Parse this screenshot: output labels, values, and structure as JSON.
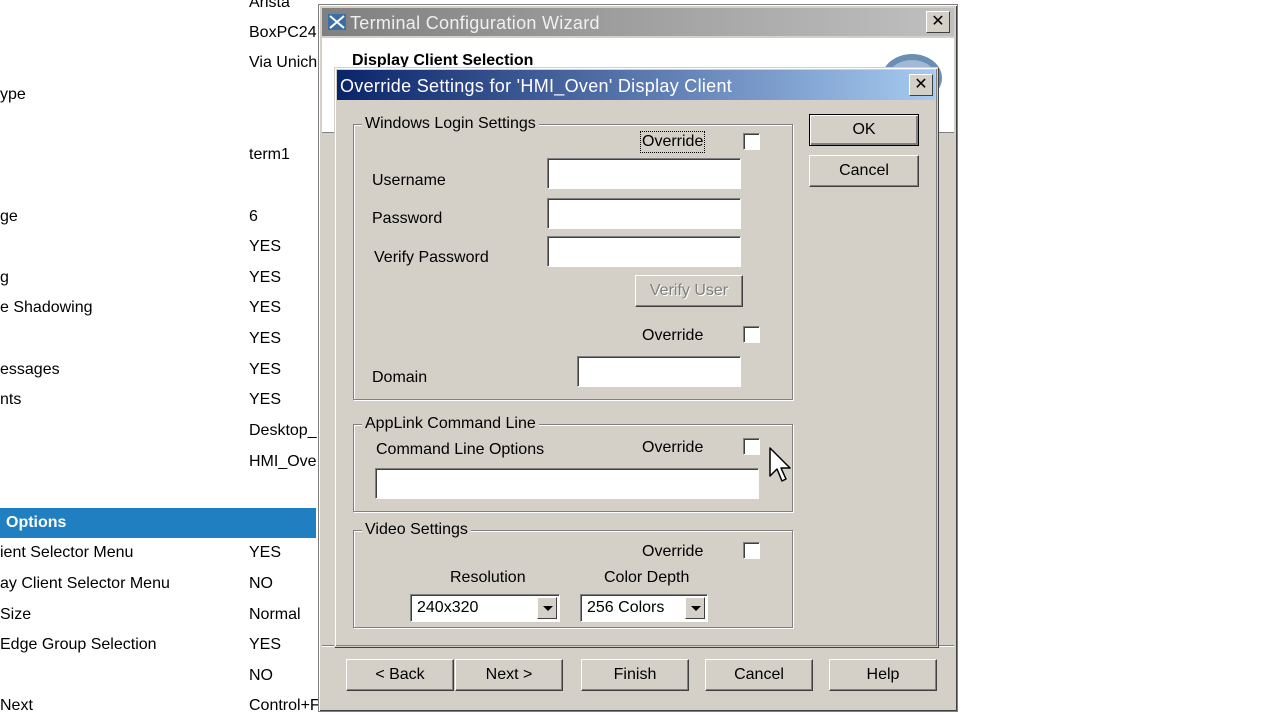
{
  "background_list": {
    "rows": [
      {
        "key": "",
        "value": "Arista"
      },
      {
        "key": "",
        "value": "BoxPC24"
      },
      {
        "key": "",
        "value": "Via Unich"
      },
      {
        "key": "ype",
        "value": ""
      },
      {
        "key": "",
        "value": "term1"
      },
      {
        "key": "ge",
        "value": "6"
      },
      {
        "key": "",
        "value": "YES"
      },
      {
        "key": "g",
        "value": "YES"
      },
      {
        "key": "e Shadowing",
        "value": "YES"
      },
      {
        "key": "",
        "value": "YES"
      },
      {
        "key": "essages",
        "value": "YES"
      },
      {
        "key": "nts",
        "value": "YES"
      },
      {
        "key": "",
        "value": "Desktop_"
      },
      {
        "key": "",
        "value": "HMI_Ove"
      },
      {
        "key": "ient Selector Menu",
        "value": "YES"
      },
      {
        "key": "ay Client Selector Menu",
        "value": "NO"
      },
      {
        "key": "Size",
        "value": "Normal"
      },
      {
        "key": "Edge Group Selection",
        "value": "YES"
      },
      {
        "key": "",
        "value": "NO"
      },
      {
        "key": "Next",
        "value": "Control+F"
      }
    ],
    "section_header": "Options"
  },
  "wizard": {
    "title": "Terminal Configuration Wizard",
    "close_label": "✕",
    "header_title": "Display Client Selection",
    "buttons": {
      "back": "< Back",
      "next": "Next >",
      "finish": "Finish",
      "cancel": "Cancel",
      "help": "Help"
    }
  },
  "dialog": {
    "title": "Override Settings for 'HMI_Oven' Display Client",
    "close_label": "✕",
    "ok": "OK",
    "cancel": "Cancel",
    "login_group": {
      "label": "Windows Login Settings",
      "override_label": "Override",
      "override_checked": false,
      "username_label": "Username",
      "username_value": "",
      "password_label": "Password",
      "password_value": "",
      "verify_password_label": "Verify Password",
      "verify_password_value": "",
      "verify_user": "Verify User",
      "domain_override_label": "Override",
      "domain_override_checked": false,
      "domain_label": "Domain",
      "domain_value": ""
    },
    "applink_group": {
      "label": "AppLink Command Line",
      "options_label": "Command Line Options",
      "override_label": "Override",
      "override_checked": false,
      "command_value": ""
    },
    "video_group": {
      "label": "Video Settings",
      "override_label": "Override",
      "override_checked": false,
      "resolution_label": "Resolution",
      "resolution_value": "240x320",
      "color_depth_label": "Color Depth",
      "color_depth_value": "256 Colors"
    }
  },
  "colors": {
    "dialog_title_start": "#0a246a",
    "dialog_title_end": "#a6caf0",
    "window_face": "#d4d0c8",
    "section_header": "#1f7fc0"
  }
}
